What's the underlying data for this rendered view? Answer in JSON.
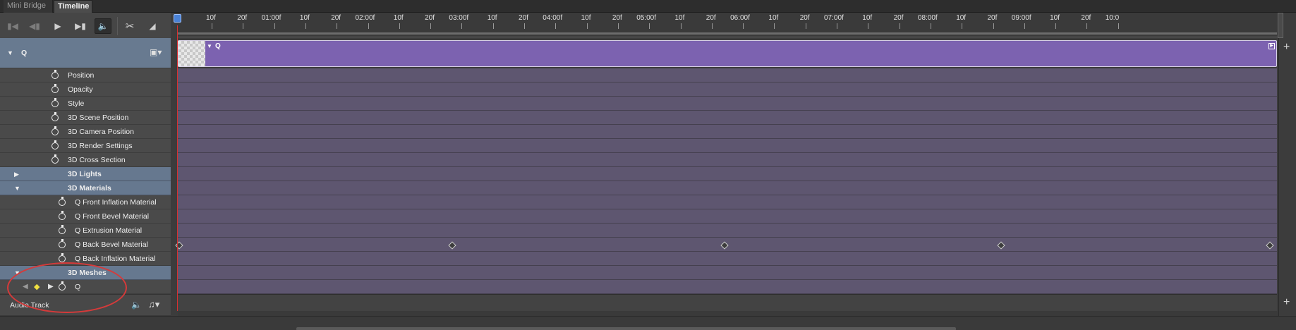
{
  "tabs": [
    {
      "label": "Mini Bridge",
      "active": false
    },
    {
      "label": "Timeline",
      "active": true
    }
  ],
  "controls": [
    {
      "name": "go-to-first-frame",
      "icon": "skip-start-icon"
    },
    {
      "name": "previous-frame",
      "icon": "step-back-icon"
    },
    {
      "name": "play",
      "icon": "play-icon"
    },
    {
      "name": "next-frame",
      "icon": "step-forward-icon"
    },
    {
      "name": "audio-toggle",
      "icon": "speaker-icon"
    },
    {
      "name": "split-at-playhead",
      "icon": "scissors-icon"
    },
    {
      "name": "transition",
      "icon": "transition-icon"
    }
  ],
  "layer": {
    "name": "Q"
  },
  "properties": [
    "Position",
    "Opacity",
    "Style",
    "3D Scene Position",
    "3D Camera Position",
    "3D Render Settings",
    "3D Cross Section"
  ],
  "groups": {
    "lights": "3D Lights",
    "materials": "3D Materials",
    "meshes": "3D Meshes"
  },
  "materials": [
    "Q Front Inflation Material",
    "Q Front Bevel Material",
    "Q Extrusion Material",
    "Q Back Bevel Material",
    "Q Back Inflation Material"
  ],
  "mesh": {
    "name": "Q"
  },
  "audio_track": "Audio Track",
  "ruler_labels": [
    "10f",
    "20f",
    "01:00f",
    "10f",
    "20f",
    "02:00f",
    "10f",
    "20f",
    "03:00f",
    "10f",
    "20f",
    "04:00f",
    "10f",
    "20f",
    "05:00f",
    "10f",
    "20f",
    "06:00f",
    "10f",
    "20f",
    "07:00f",
    "10f",
    "20f",
    "08:00f",
    "10f",
    "20f",
    "09:00f",
    "10f",
    "20f",
    "10:0"
  ],
  "clip": {
    "label": "Q"
  },
  "keyframe_frames": [
    0,
    75,
    150,
    226,
    300
  ],
  "colors": {
    "clip": "#7c62b0",
    "track": "#5e5670",
    "group_row": "#66788f",
    "playhead": "#d83030",
    "annotation": "#d63a3a",
    "keyframe_selected": "#f0e040"
  }
}
